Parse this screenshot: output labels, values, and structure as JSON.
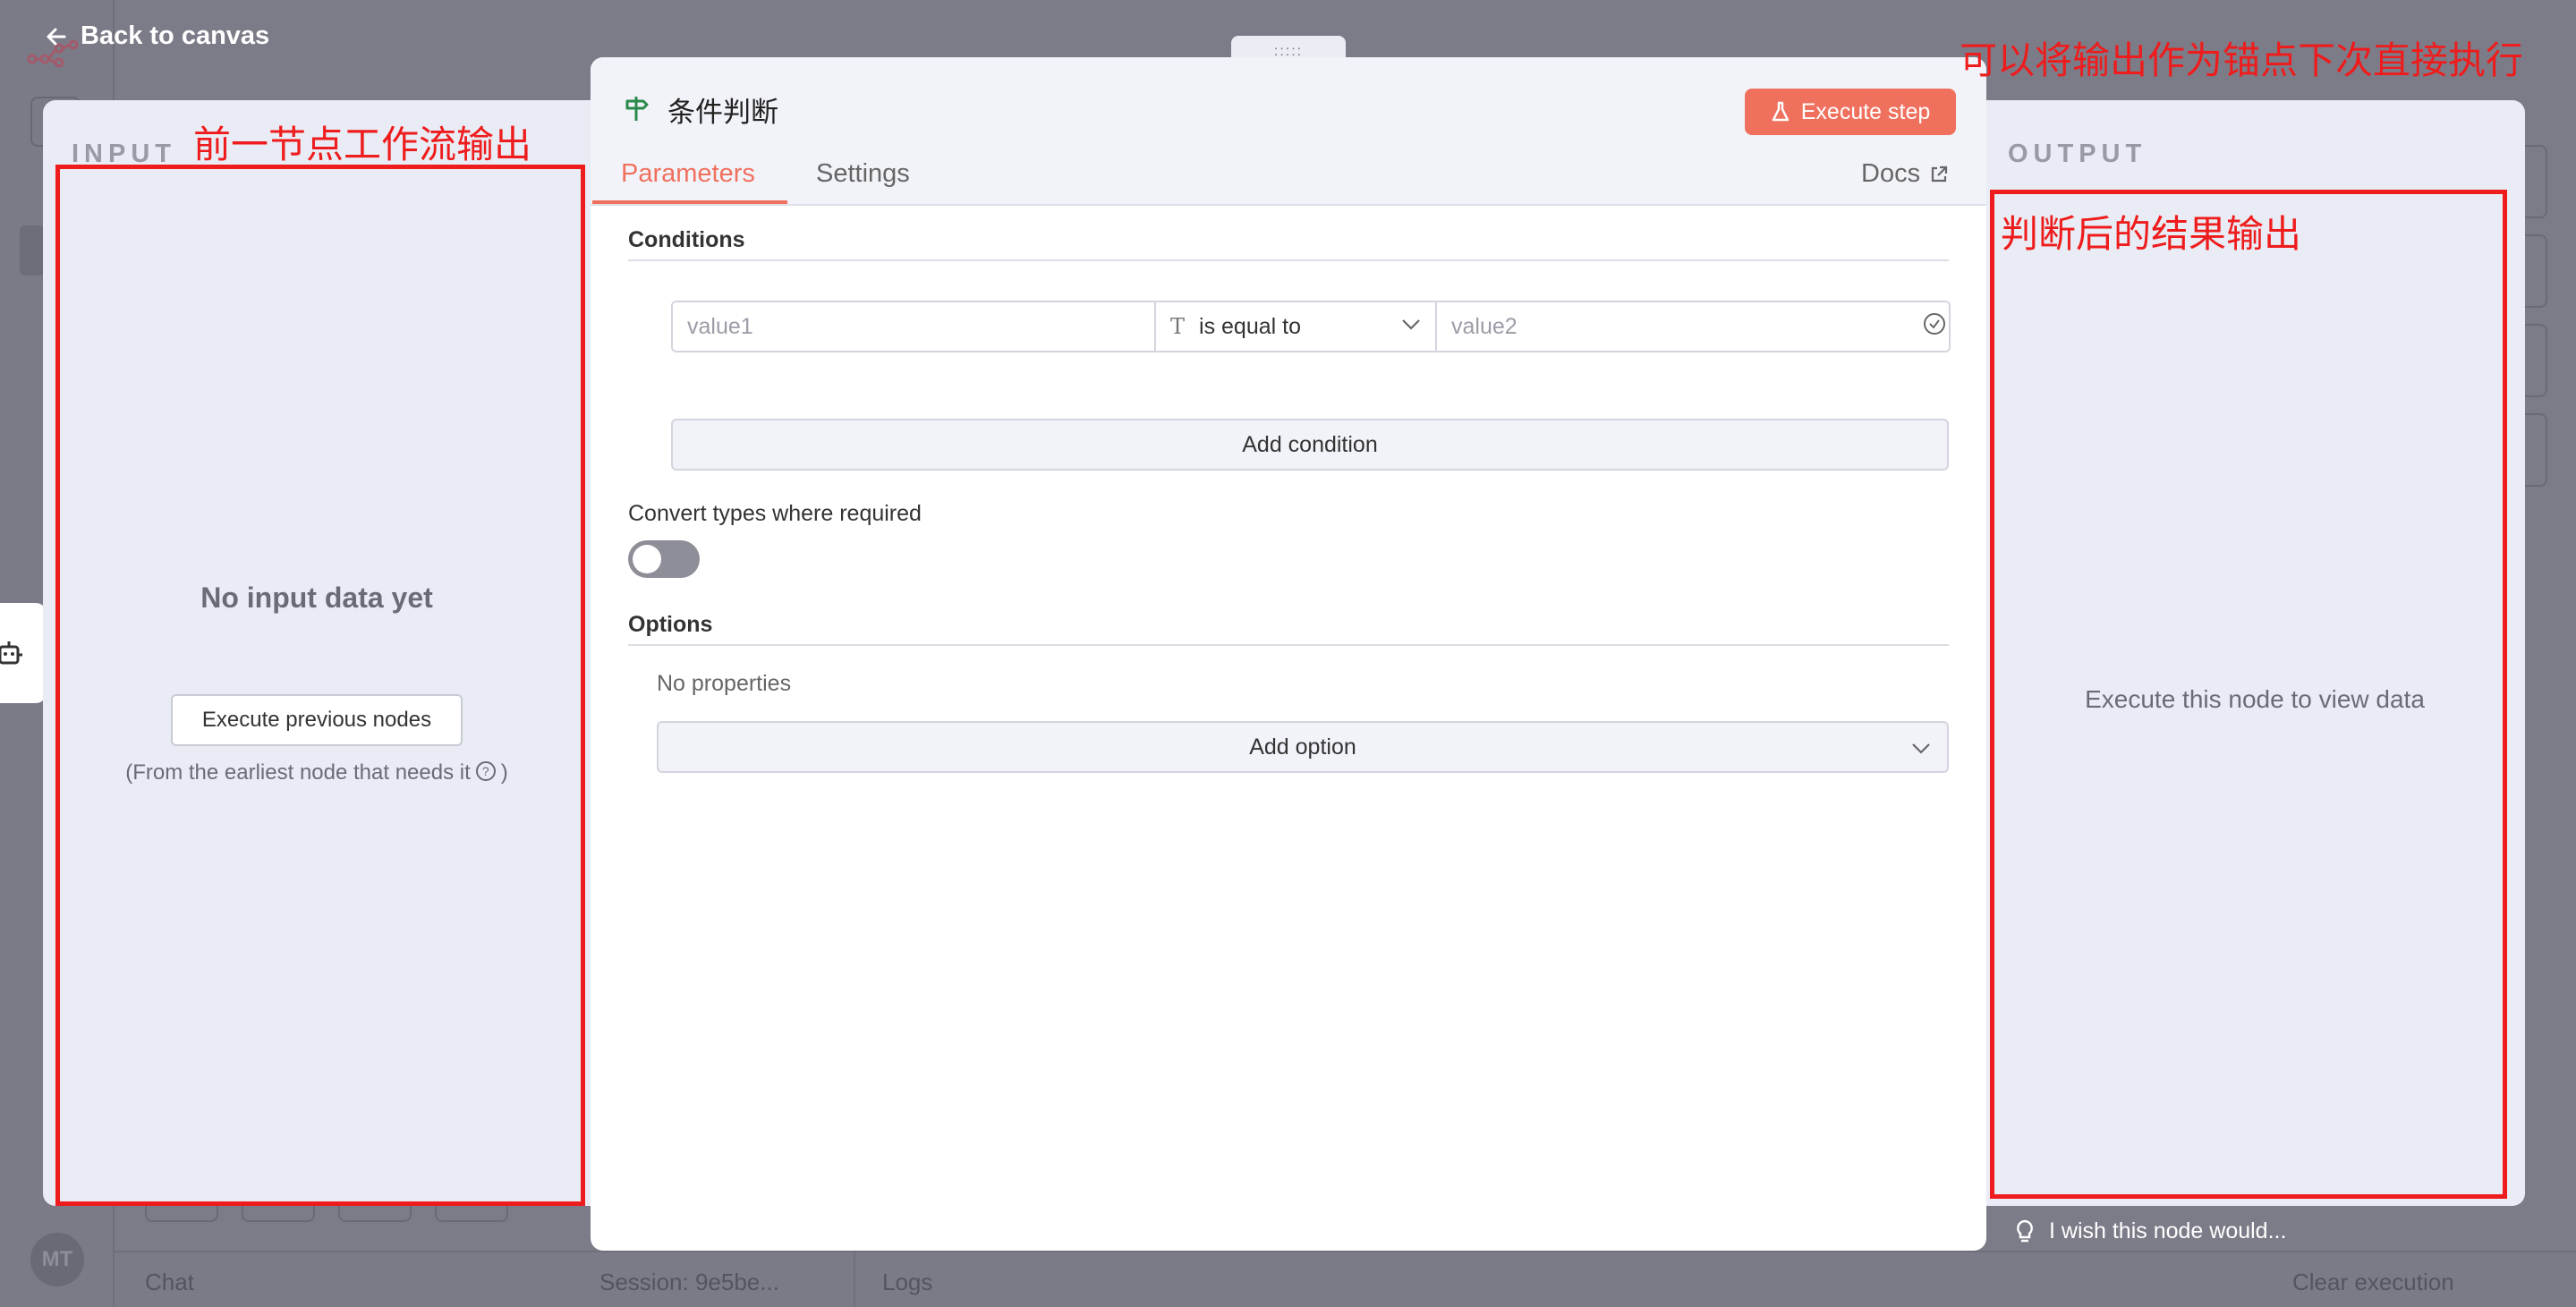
{
  "top": {
    "back_label": "Back to canvas"
  },
  "input_panel": {
    "label": "INPUT",
    "empty_title": "No input data yet",
    "execute_previous_label": "Execute previous nodes",
    "earliest_note_prefix": "(From the earliest node that needs it",
    "earliest_note_suffix": ")"
  },
  "node": {
    "title": "条件判断",
    "execute_label": "Execute step",
    "tabs": [
      {
        "label": "Parameters",
        "active": true
      },
      {
        "label": "Settings",
        "active": false
      }
    ],
    "docs_label": "Docs",
    "conditions_label": "Conditions",
    "condition": {
      "value1_placeholder": "value1",
      "operator": "is equal to",
      "value2_placeholder": "value2"
    },
    "add_condition_label": "Add condition",
    "convert_types_label": "Convert types where required",
    "convert_types_enabled": false,
    "options_label": "Options",
    "no_properties_label": "No properties",
    "add_option_label": "Add option"
  },
  "output_panel": {
    "label": "OUTPUT",
    "empty_text": "Execute this node to view data",
    "wish_label": "I wish this node would..."
  },
  "background": {
    "avatar_initials": "MT",
    "chat_label": "Chat",
    "session_label": "Session: 9e5be...",
    "logs_label": "Logs",
    "clear_execution_label": "Clear execution"
  },
  "annotations": {
    "input_note": "前一节点工作流输出",
    "output_note": "判断后的结果输出",
    "top_note": "可以将输出作为锚点下次直接执行"
  },
  "colors": {
    "accent": "#f0705e",
    "annotation_red": "#ee1c1c",
    "overlay": "#7c7c89",
    "node_icon": "#2a8a4a"
  }
}
